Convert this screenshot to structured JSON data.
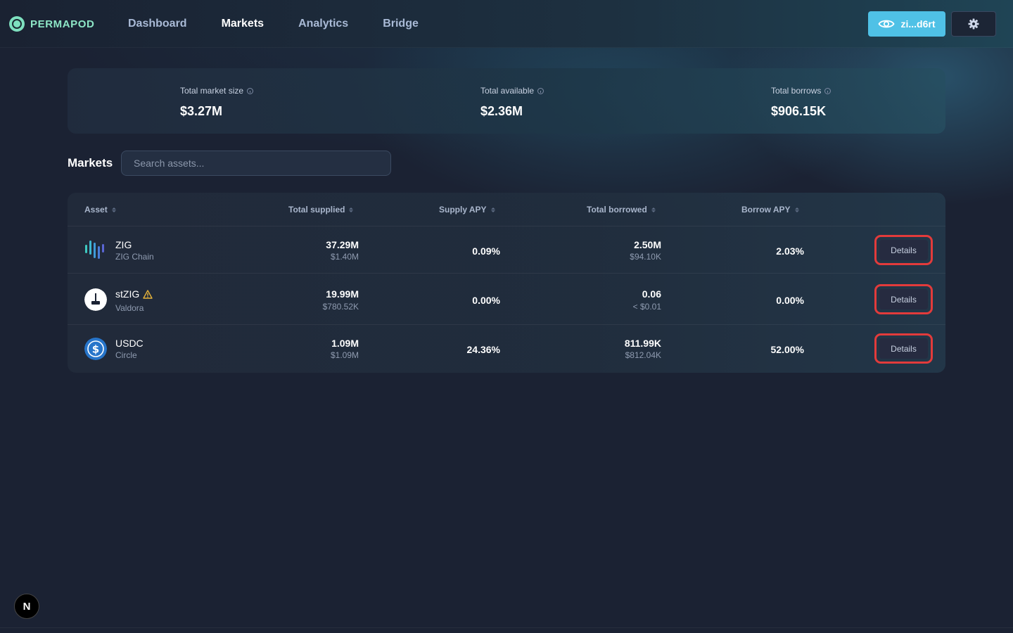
{
  "brand": {
    "name": "PERMAPOD",
    "accent": "#8de6c6"
  },
  "nav": {
    "items": [
      {
        "label": "Dashboard",
        "active": false
      },
      {
        "label": "Markets",
        "active": true
      },
      {
        "label": "Analytics",
        "active": false
      },
      {
        "label": "Bridge",
        "active": false
      }
    ]
  },
  "wallet": {
    "label": "zi...d6rt",
    "icon": "eye-icon",
    "color": "#4fc1e6"
  },
  "settings": {
    "icon": "gear-icon"
  },
  "stats": [
    {
      "label": "Total market size",
      "value": "$3.27M"
    },
    {
      "label": "Total available",
      "value": "$2.36M"
    },
    {
      "label": "Total borrows",
      "value": "$906.15K"
    }
  ],
  "markets": {
    "title": "Markets",
    "search_placeholder": "Search assets...",
    "columns": [
      "Asset",
      "Total supplied",
      "Supply APY",
      "Total borrowed",
      "Borrow APY"
    ],
    "rows": [
      {
        "symbol": "ZIG",
        "name": "ZIG Chain",
        "icon": "zig-icon",
        "warning": false,
        "supplied": "37.29M",
        "supplied_usd": "$1.40M",
        "supply_apy": "0.09%",
        "borrowed": "2.50M",
        "borrowed_usd": "$94.10K",
        "borrow_apy": "2.03%",
        "action": "Details"
      },
      {
        "symbol": "stZIG",
        "name": "Valdora",
        "icon": "stzig-icon",
        "warning": true,
        "supplied": "19.99M",
        "supplied_usd": "$780.52K",
        "supply_apy": "0.00%",
        "borrowed": "0.06",
        "borrowed_usd": "< $0.01",
        "borrow_apy": "0.00%",
        "action": "Details"
      },
      {
        "symbol": "USDC",
        "name": "Circle",
        "icon": "usdc-icon",
        "warning": false,
        "supplied": "1.09M",
        "supplied_usd": "$1.09M",
        "supply_apy": "24.36%",
        "borrowed": "811.99K",
        "borrowed_usd": "$812.04K",
        "borrow_apy": "52.00%",
        "action": "Details"
      }
    ]
  },
  "dev_badge": {
    "label": "N"
  },
  "colors": {
    "highlight": "#e23b3b",
    "background": "#1b2233"
  }
}
